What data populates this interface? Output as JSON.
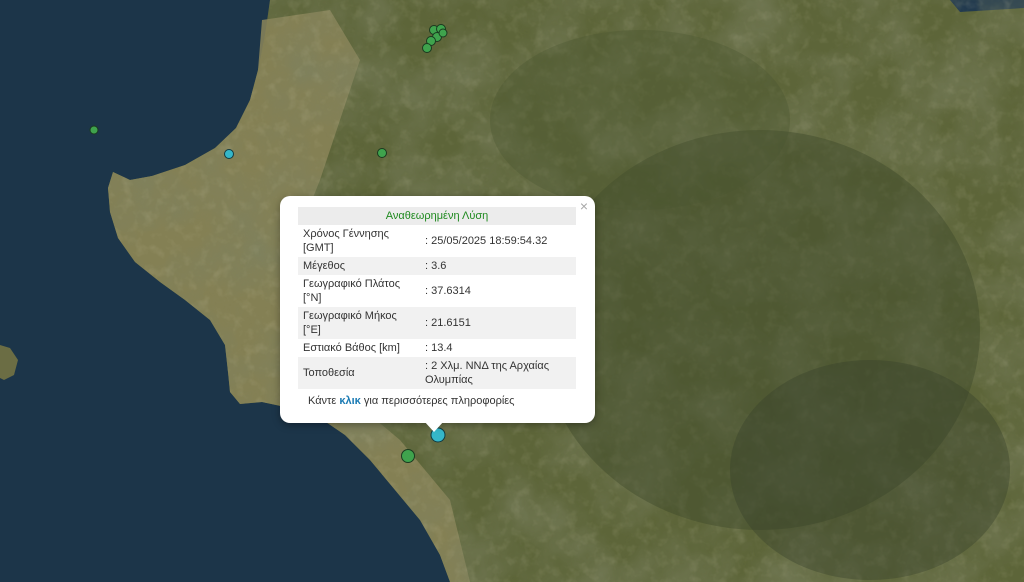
{
  "map": {
    "background": "satellite-terrain",
    "colors": {
      "sea": "#1b3449",
      "land": "#5b6437",
      "coast_plain": "#8a8458",
      "quake_green": "#3fa34d",
      "quake_cyan": "#35b7c9"
    }
  },
  "popup": {
    "title": "Αναθεωρημένη Λύση",
    "rows": [
      {
        "label": "Χρόνος Γέννησης [GMT]",
        "value": ": 25/05/2025 18:59:54.32"
      },
      {
        "label": "Μέγεθος",
        "value": ": 3.6"
      },
      {
        "label": "Γεωγραφικό Πλάτος [°N]",
        "value": ": 37.6314"
      },
      {
        "label": "Γεωγραφικό Μήκος [°E]",
        "value": ": 21.6151"
      },
      {
        "label": "Εστιακό Βάθος [km]",
        "value": ": 13.4"
      },
      {
        "label": "Τοποθεσία",
        "value": ": 2 Χλμ. ΝΝΔ της Αρχαίας Ολυμπίας"
      }
    ],
    "more_prefix": "Κάντε ",
    "more_link": "κλικ",
    "more_suffix": " για περισσότερες πληροφορίες",
    "close_icon": "close-icon"
  }
}
